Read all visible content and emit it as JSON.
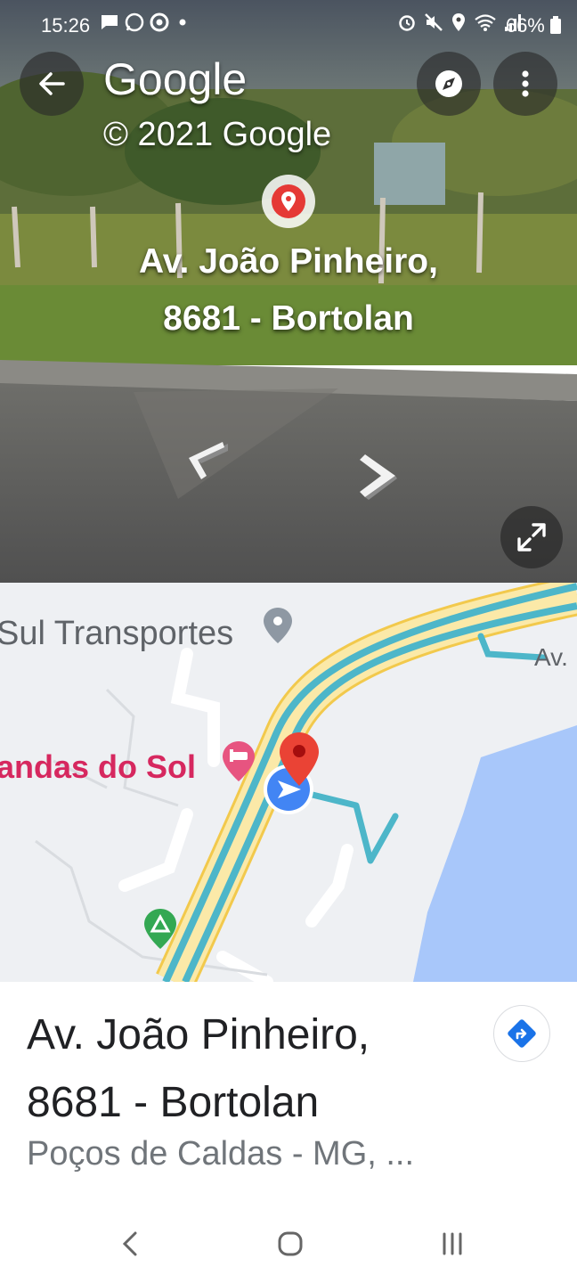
{
  "status_bar": {
    "time": "15:26",
    "battery": "66%",
    "left_icons": [
      "message-icon",
      "whatsapp-icon",
      "chrome-icon",
      "dot-icon"
    ],
    "right_icons": [
      "alarm-icon",
      "mute-icon",
      "location-icon",
      "wifi-icon",
      "signal-icon",
      "battery-icon"
    ]
  },
  "street_view": {
    "brand": "Google",
    "copyright": "© 2021 Google",
    "address_line1": "Av. João Pinheiro,",
    "address_line2": "8681 - Bortolan",
    "icons": {
      "back": "back-arrow-icon",
      "compass": "compass-icon",
      "more": "more-vert-icon",
      "place": "place-pin-icon",
      "prev": "chevron-left-icon",
      "next": "chevron-right-icon",
      "expand": "expand-icon"
    }
  },
  "map": {
    "poi_transport": "Sul Transportes",
    "poi_hotel": "andas do Sol",
    "road_label": "Av.",
    "colors": {
      "water": "#a8c7fa",
      "road": "#f6d77c",
      "route": "#4db6c9",
      "hotel": "#d6285f",
      "pin": "#ea4335",
      "location": "#4285f4"
    }
  },
  "info": {
    "title_line1": "Av. João Pinheiro,",
    "title_line2": "8681 - Bortolan",
    "subtitle": "Poços de Caldas - MG, ..."
  },
  "nav_bar": {
    "keys": [
      "recent-apps-icon",
      "home-icon",
      "back-icon"
    ]
  }
}
